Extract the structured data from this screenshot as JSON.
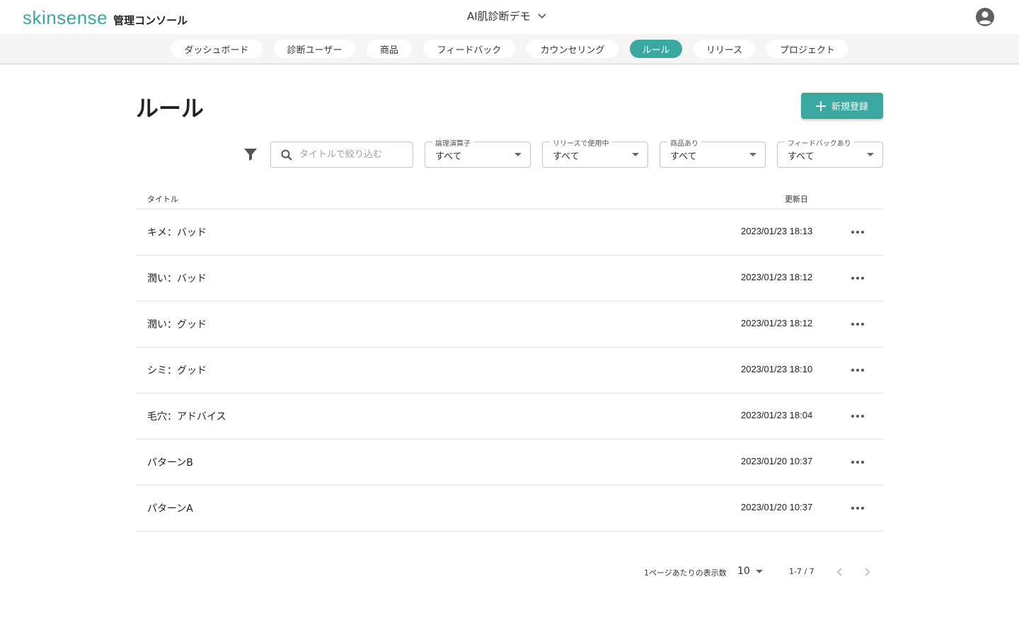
{
  "header": {
    "brand": "skinsense",
    "brand_sub": "管理コンソール",
    "project": "AI肌診断デモ",
    "account_icon": "account-circle-icon"
  },
  "nav": {
    "active": "ルール",
    "tabs": [
      {
        "label": "ダッシュボード"
      },
      {
        "label": "診断ユーザー"
      },
      {
        "label": "商品"
      },
      {
        "label": "フィードバック"
      },
      {
        "label": "カウンセリング"
      },
      {
        "label": "ルール"
      },
      {
        "label": "リリース"
      },
      {
        "label": "プロジェクト"
      }
    ]
  },
  "page": {
    "title": "ルール",
    "new_button": "新規登録"
  },
  "filters": {
    "search_placeholder": "タイトルで絞り込む",
    "selects": [
      {
        "label": "論理演算子",
        "value": "すべて"
      },
      {
        "label": "リリースで使用中",
        "value": "すべて"
      },
      {
        "label": "商品あり",
        "value": "すべて"
      },
      {
        "label": "フィードバックあり",
        "value": "すべて"
      }
    ]
  },
  "table": {
    "columns": {
      "title": "タイトル",
      "updated": "更新日"
    },
    "rows": [
      {
        "title": "キメ：バッド",
        "updated": "2023/01/23 18:13"
      },
      {
        "title": "潤い：バッド",
        "updated": "2023/01/23 18:12"
      },
      {
        "title": "潤い：グッド",
        "updated": "2023/01/23 18:12"
      },
      {
        "title": "シミ：グッド",
        "updated": "2023/01/23 18:10"
      },
      {
        "title": "毛穴：アドバイス",
        "updated": "2023/01/23 18:04"
      },
      {
        "title": "パターンB",
        "updated": "2023/01/20 10:37"
      },
      {
        "title": "パターンA",
        "updated": "2023/01/20 10:37"
      }
    ]
  },
  "pagination": {
    "rows_per_page_label": "1ページあたりの表示数",
    "rows_per_page": "10",
    "range": "1-7 / 7"
  },
  "colors": {
    "accent": "#3aa8a0"
  }
}
